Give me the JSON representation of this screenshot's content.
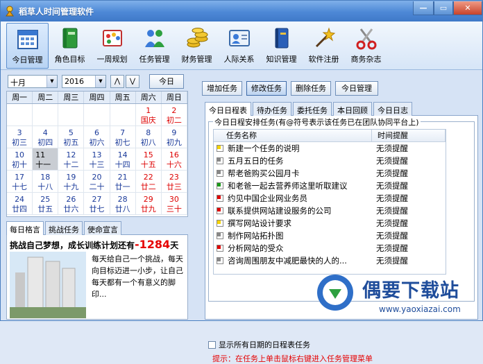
{
  "app": {
    "title": "稻草人时间管理软件",
    "window_controls": {
      "minimize": "—",
      "maximize": "▭",
      "close": "✕"
    }
  },
  "toolbar": {
    "items": [
      {
        "label": "今日管理",
        "icon": "calendar-icon"
      },
      {
        "label": "角色目标",
        "icon": "book-icon"
      },
      {
        "label": "一周规划",
        "icon": "palette-icon"
      },
      {
        "label": "任务管理",
        "icon": "people-icon"
      },
      {
        "label": "财务管理",
        "icon": "coins-icon"
      },
      {
        "label": "人际关系",
        "icon": "contact-card-icon"
      },
      {
        "label": "知识管理",
        "icon": "knowledge-book-icon"
      },
      {
        "label": "软件注册",
        "icon": "magic-wand-icon"
      },
      {
        "label": "商务杂志",
        "icon": "scissors-icon"
      }
    ]
  },
  "datebar": {
    "month": "十月",
    "year": "2016",
    "prev": "⋀",
    "next": "⋁",
    "today": "今日"
  },
  "calendar": {
    "weekdays": [
      "周一",
      "周二",
      "周三",
      "周四",
      "周五",
      "周六",
      "周日"
    ],
    "cells": [
      {
        "d": "",
        "l": "",
        "w": false
      },
      {
        "d": "",
        "l": "",
        "w": false
      },
      {
        "d": "",
        "l": "",
        "w": false
      },
      {
        "d": "",
        "l": "",
        "w": false
      },
      {
        "d": "",
        "l": "",
        "w": false
      },
      {
        "d": "1",
        "l": "国庆",
        "w": true
      },
      {
        "d": "2",
        "l": "初二",
        "w": true
      },
      {
        "d": "3",
        "l": "初三",
        "w": false
      },
      {
        "d": "4",
        "l": "初四",
        "w": false
      },
      {
        "d": "5",
        "l": "初五",
        "w": false
      },
      {
        "d": "6",
        "l": "初六",
        "w": false
      },
      {
        "d": "7",
        "l": "初七",
        "w": false
      },
      {
        "d": "8",
        "l": "初八",
        "w": false
      },
      {
        "d": "9",
        "l": "初九",
        "w": false
      },
      {
        "d": "10",
        "l": "初十",
        "w": false
      },
      {
        "d": "11",
        "l": "十一",
        "w": false,
        "today": true
      },
      {
        "d": "12",
        "l": "十二",
        "w": false
      },
      {
        "d": "13",
        "l": "十三",
        "w": false
      },
      {
        "d": "14",
        "l": "十四",
        "w": false
      },
      {
        "d": "15",
        "l": "十五",
        "w": true
      },
      {
        "d": "16",
        "l": "十六",
        "w": true
      },
      {
        "d": "17",
        "l": "十七",
        "w": false
      },
      {
        "d": "18",
        "l": "十八",
        "w": false
      },
      {
        "d": "19",
        "l": "十九",
        "w": false
      },
      {
        "d": "20",
        "l": "二十",
        "w": false
      },
      {
        "d": "21",
        "l": "廿一",
        "w": false
      },
      {
        "d": "22",
        "l": "廿二",
        "w": true
      },
      {
        "d": "23",
        "l": "廿三",
        "w": true
      },
      {
        "d": "24",
        "l": "廿四",
        "w": false
      },
      {
        "d": "25",
        "l": "廿五",
        "w": false
      },
      {
        "d": "26",
        "l": "廿六",
        "w": false
      },
      {
        "d": "27",
        "l": "廿七",
        "w": false
      },
      {
        "d": "28",
        "l": "廿八",
        "w": false
      },
      {
        "d": "29",
        "l": "廿九",
        "w": true
      },
      {
        "d": "30",
        "l": "三十",
        "w": true
      }
    ]
  },
  "left_tabs": [
    "每日格言",
    "挑战任务",
    "使命宣言"
  ],
  "motto": {
    "headline_prefix": "挑战自己梦想，成长训练计划还有",
    "days": "-1284",
    "headline_suffix": "天",
    "text": "每天给自己一个挑战，每天向目标迈进一小步，让自己每天都有一个有意义的脚印..."
  },
  "task_buttons": [
    "增加任务",
    "修改任务",
    "删除任务",
    "今日管理"
  ],
  "right_tabs": [
    "今日日程表",
    "待办任务",
    "委托任务",
    "本日回顾",
    "今日日志"
  ],
  "schedule": {
    "legend": "今日日程安排任务(有@符号表示该任务已在团队协同平台上)",
    "col_name": "任务名称",
    "col_remind": "时间提醒",
    "rows": [
      {
        "name": "新建一个任务的说明",
        "remind": "无须提醒",
        "color": "#f5d400"
      },
      {
        "name": "五月五日的任务",
        "remind": "无须提醒",
        "color": "#888888"
      },
      {
        "name": "帮老爸购买公园月卡",
        "remind": "无须提醒",
        "color": "#888888"
      },
      {
        "name": "和老爸一起去营养师这里听取建议",
        "remind": "无须提醒",
        "color": "#1a9a1a"
      },
      {
        "name": "约见中国企业网业务员",
        "remind": "无须提醒",
        "color": "#e00000"
      },
      {
        "name": "联系提供网站建设服务的公司",
        "remind": "无须提醒",
        "color": "#e00000"
      },
      {
        "name": "撰写网站设计要求",
        "remind": "无须提醒",
        "color": "#f5d400"
      },
      {
        "name": "制作网站拓扑图",
        "remind": "无须提醒",
        "color": "#888888"
      },
      {
        "name": "分析网站的受众",
        "remind": "无须提醒",
        "color": "#e00000"
      },
      {
        "name": "咨询周围朋友中减肥最快的人的...",
        "remind": "无须提醒",
        "color": "#888888"
      }
    ],
    "show_all": "显示所有日期的日程表任务",
    "tip": "提示：在任务上单击鼠标右键进入任务管理菜单"
  },
  "watermark": {
    "title": "偶要下载站",
    "url": "www.yaoxiazai.com"
  }
}
